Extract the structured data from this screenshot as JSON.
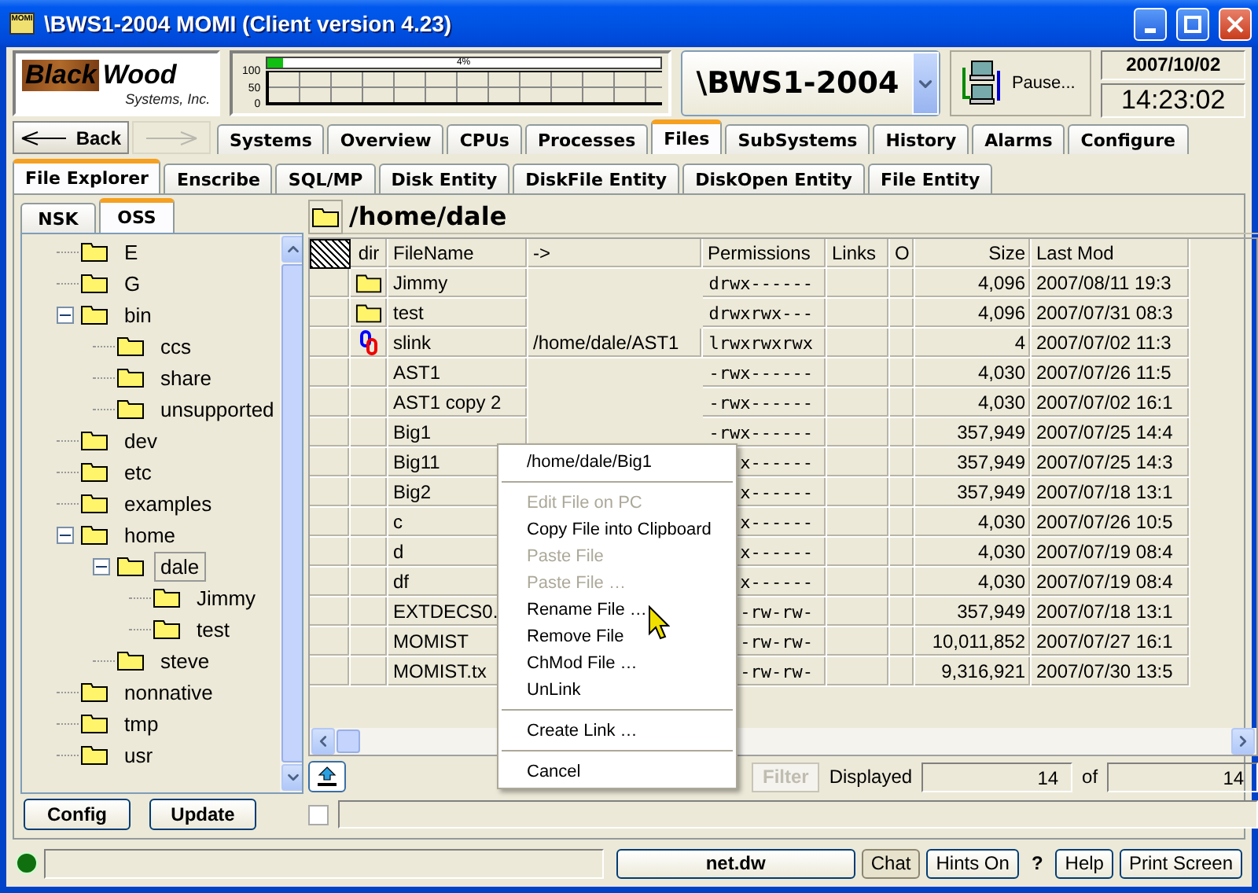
{
  "window": {
    "title": "\\BWS1-2004 MOMI (Client version 4.23)",
    "icon_label": "MOMI"
  },
  "logo": {
    "word_1": "Black",
    "word_2": "Wood",
    "tagline": "Systems, Inc."
  },
  "cpu_meter": {
    "percent_label": "4%",
    "level": 0.04,
    "axis_labels": [
      "100",
      "50",
      "0"
    ]
  },
  "system_selector": {
    "value": "\\BWS1-2004"
  },
  "pause_button": {
    "label": "Pause..."
  },
  "clock": {
    "date": "2007/10/02",
    "time": "14:23:02"
  },
  "nav": {
    "back_label": "Back",
    "forward_disabled": true
  },
  "main_tabs": [
    {
      "label": "Systems",
      "selected": false
    },
    {
      "label": "Overview",
      "selected": false
    },
    {
      "label": "CPUs",
      "selected": false
    },
    {
      "label": "Processes",
      "selected": false
    },
    {
      "label": "Files",
      "selected": true
    },
    {
      "label": "SubSystems",
      "selected": false
    },
    {
      "label": "History",
      "selected": false
    },
    {
      "label": "Alarms",
      "selected": false
    },
    {
      "label": "Configure",
      "selected": false
    }
  ],
  "sub_tabs": [
    {
      "label": "File Explorer",
      "selected": true
    },
    {
      "label": "Enscribe",
      "selected": false
    },
    {
      "label": "SQL/MP",
      "selected": false
    },
    {
      "label": "Disk Entity",
      "selected": false
    },
    {
      "label": "DiskFile Entity",
      "selected": false
    },
    {
      "label": "DiskOpen Entity",
      "selected": false
    },
    {
      "label": "File Entity",
      "selected": false
    }
  ],
  "side_tabs": [
    {
      "label": "NSK",
      "selected": false
    },
    {
      "label": "OSS",
      "selected": true
    }
  ],
  "tree": [
    {
      "label": "E",
      "selected": false
    },
    {
      "label": "G",
      "selected": false
    },
    {
      "label": "bin",
      "selected": false,
      "expanded": true,
      "children": [
        {
          "label": "ccs",
          "selected": false
        },
        {
          "label": "share",
          "selected": false
        },
        {
          "label": "unsupported",
          "selected": false
        }
      ]
    },
    {
      "label": "dev",
      "selected": false
    },
    {
      "label": "etc",
      "selected": false
    },
    {
      "label": "examples",
      "selected": false
    },
    {
      "label": "home",
      "selected": false,
      "expanded": true,
      "children": [
        {
          "label": "dale",
          "selected": true,
          "expanded": true,
          "children": [
            {
              "label": "Jimmy",
              "selected": false
            },
            {
              "label": "test",
              "selected": false
            }
          ]
        },
        {
          "label": "steve",
          "selected": false
        }
      ]
    },
    {
      "label": "nonnative",
      "selected": false
    },
    {
      "label": "tmp",
      "selected": false
    },
    {
      "label": "usr",
      "selected": false
    }
  ],
  "path": "/home/dale",
  "table": {
    "columns": [
      "dir",
      "FileName",
      "->",
      "Permissions",
      "Links",
      "O",
      "Size",
      "Last Mod"
    ],
    "rows": [
      {
        "kind": "folder",
        "name": "Jimmy",
        "permissions": "drwx------",
        "size": "4,096",
        "last_mod": "2007/08/11 19:3"
      },
      {
        "kind": "folder",
        "name": "test",
        "permissions": "drwxrwx---",
        "size": "4,096",
        "last_mod": "2007/07/31 08:3"
      },
      {
        "kind": "link",
        "name": "slink",
        "target": "/home/dale/AST1",
        "permissions": "lrwxrwxrwx",
        "size": "4",
        "last_mod": "2007/07/02 11:3"
      },
      {
        "kind": "file",
        "name": "AST1",
        "permissions": "-rwx------",
        "size": "4,030",
        "last_mod": "2007/07/26 11:5"
      },
      {
        "kind": "file",
        "name": "AST1 copy 2",
        "permissions": "-rwx------",
        "size": "4,030",
        "last_mod": "2007/07/02 16:1"
      },
      {
        "kind": "file",
        "name": "Big1",
        "permissions": "-rwx------",
        "size": "357,949",
        "last_mod": "2007/07/25 14:4"
      },
      {
        "kind": "file",
        "name": "Big11",
        "permissions": "x------",
        "size": "357,949",
        "last_mod": "2007/07/25 14:3"
      },
      {
        "kind": "file",
        "name": "Big2",
        "permissions": "x------",
        "size": "357,949",
        "last_mod": "2007/07/18 13:1"
      },
      {
        "kind": "file",
        "name": "c",
        "permissions": "x------",
        "size": "4,030",
        "last_mod": "2007/07/26 10:5"
      },
      {
        "kind": "file",
        "name": "d",
        "permissions": "x------",
        "size": "4,030",
        "last_mod": "2007/07/19 08:4"
      },
      {
        "kind": "file",
        "name": "df",
        "permissions": "x------",
        "size": "4,030",
        "last_mod": "2007/07/19 08:4"
      },
      {
        "kind": "file",
        "name": "EXTDECS0.",
        "permissions": "-rw-rw-",
        "size": "357,949",
        "last_mod": "2007/07/18 13:1"
      },
      {
        "kind": "file",
        "name": "MOMIST",
        "permissions": "-rw-rw-",
        "size": "10,011,852",
        "last_mod": "2007/07/27 16:1"
      },
      {
        "kind": "file",
        "name": "MOMIST.tx",
        "permissions": "-rw-rw-",
        "size": "9,316,921",
        "last_mod": "2007/07/30 13:5"
      }
    ]
  },
  "filter_button": {
    "label": "Filter",
    "disabled": true
  },
  "displayed": {
    "label": "Displayed",
    "value": "14",
    "of_label": "of",
    "total": "14"
  },
  "left_buttons": [
    "Config",
    "Update"
  ],
  "option_checkbox": {
    "checked": false
  },
  "status_bar": {
    "items": [
      {
        "kind": "server",
        "label": "net.dw"
      },
      {
        "kind": "toggle",
        "label": "Chat"
      },
      {
        "kind": "button",
        "label": "Hints On"
      },
      {
        "kind": "mark",
        "label": "?"
      },
      {
        "kind": "button",
        "label": "Help"
      },
      {
        "kind": "button",
        "label": "Print Screen"
      }
    ]
  },
  "context_menu": {
    "items": [
      {
        "kind": "title",
        "label": "/home/dale/Big1"
      },
      {
        "kind": "separator"
      },
      {
        "kind": "item",
        "label": "Edit File on PC",
        "disabled": true
      },
      {
        "kind": "item",
        "label": "Copy File into Clipboard",
        "disabled": false
      },
      {
        "kind": "item",
        "label": "Paste File",
        "disabled": true
      },
      {
        "kind": "item",
        "label": "Paste File  …",
        "disabled": true
      },
      {
        "kind": "item",
        "label": "Rename File …",
        "disabled": false
      },
      {
        "kind": "item",
        "label": "Remove File",
        "disabled": false
      },
      {
        "kind": "item",
        "label": "ChMod File …",
        "disabled": false
      },
      {
        "kind": "item",
        "label": "UnLink",
        "disabled": false
      },
      {
        "kind": "separator"
      },
      {
        "kind": "item",
        "label": "Create Link …",
        "disabled": false
      },
      {
        "kind": "separator"
      },
      {
        "kind": "item",
        "label": "Cancel",
        "disabled": false
      }
    ]
  }
}
